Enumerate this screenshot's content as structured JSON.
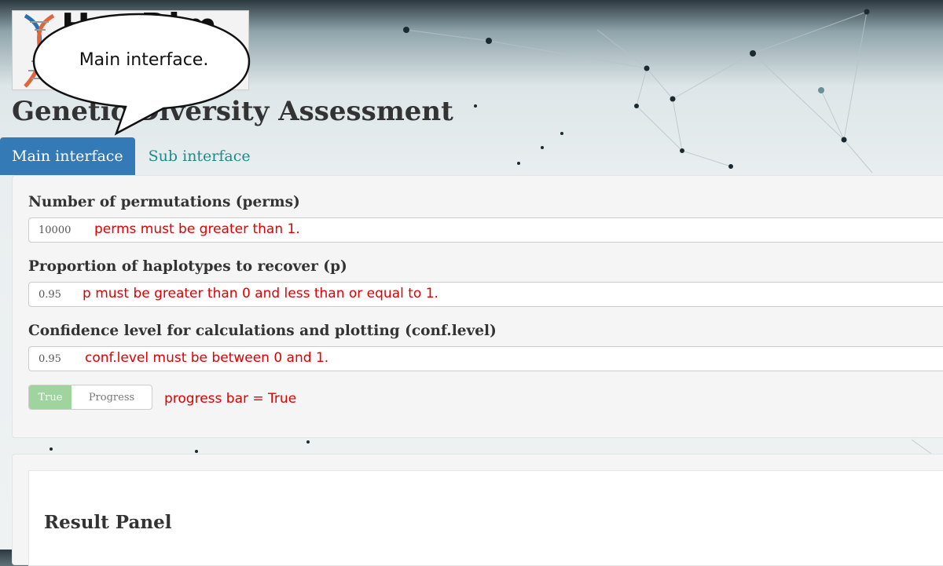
{
  "header": {
    "logo_text": "HapRim",
    "title": "Genetic Diversity Assessment"
  },
  "callout": {
    "text": "Main interface."
  },
  "tabs": [
    {
      "label": "Main interface",
      "active": true
    },
    {
      "label": "Sub interface",
      "active": false
    }
  ],
  "form": {
    "perms": {
      "label": "Number of permutations (perms)",
      "value": "10000",
      "note": "perms must be greater than 1."
    },
    "p": {
      "label": "Proportion of haplotypes to recover (p)",
      "value": "0.95",
      "note": "p must be greater than 0 and less than or equal to 1."
    },
    "conf": {
      "label": "Confidence level for calculations and plotting (conf.level)",
      "value": "0.95",
      "note": "conf.level must be between 0 and 1."
    },
    "progress": {
      "on_label": "True",
      "off_label": "Progress",
      "note": "progress bar = True"
    }
  },
  "result": {
    "title": "Result Panel"
  },
  "colors": {
    "tab_active": "#337ab7",
    "tab_inactive_text": "#1f8a8a",
    "annotation": "#e00000",
    "toggle_on": "#9fd49f"
  }
}
